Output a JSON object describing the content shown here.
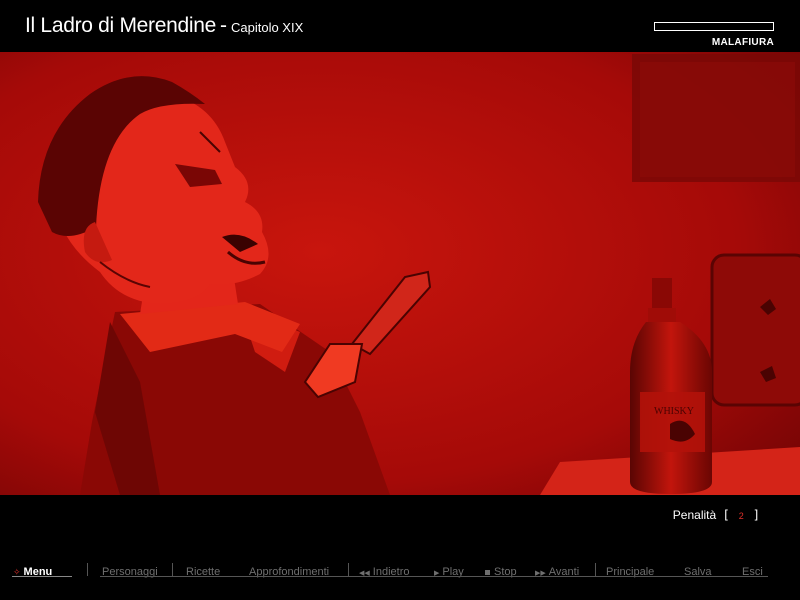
{
  "header": {
    "title": "Il Ladro di Merendine",
    "separator": "-",
    "chapter": "Capitolo XIX",
    "brand": "MALAFIURA"
  },
  "scene": {
    "description_icon": "crime-scene-illustration",
    "bottle_label": "WHISKY"
  },
  "penalty": {
    "label": "Penalità",
    "open": "[",
    "value": "2",
    "close": "]"
  },
  "menu": {
    "menu": "Menu",
    "personaggi": "Personaggi",
    "ricette": "Ricette",
    "approfondimenti": "Approfondimenti",
    "indietro": "Indietro",
    "play": "Play",
    "stop": "Stop",
    "avanti": "Avanti",
    "principale": "Principale",
    "salva": "Salva",
    "esci": "Esci"
  },
  "colors": {
    "accent": "#e0302a",
    "scene_red": "#b30a0a",
    "menu_inactive": "#6f6f6f"
  }
}
